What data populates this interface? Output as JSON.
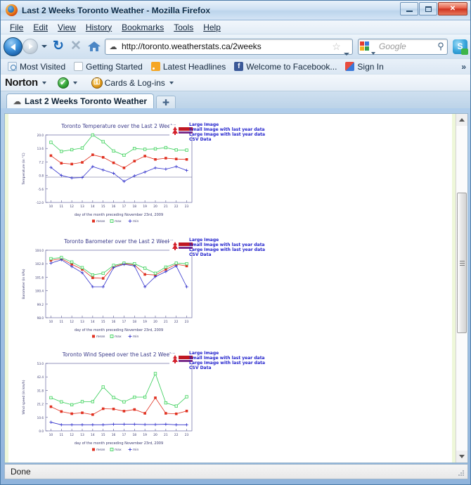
{
  "window": {
    "title": "Last 2 Weeks Toronto Weather - Mozilla Firefox",
    "minimize_label": "–",
    "maximize_label": "❐",
    "close_label": "✕"
  },
  "menubar": {
    "items": [
      {
        "label": "File",
        "accel": "F"
      },
      {
        "label": "Edit",
        "accel": "E"
      },
      {
        "label": "View",
        "accel": "V"
      },
      {
        "label": "History",
        "accel": "s"
      },
      {
        "label": "Bookmarks",
        "accel": "B"
      },
      {
        "label": "Tools",
        "accel": "T"
      },
      {
        "label": "Help",
        "accel": "H"
      }
    ]
  },
  "navbar": {
    "back_icon": "back-arrow-icon",
    "forward_icon": "forward-arrow-icon",
    "history_dropdown_icon": "chevron-down-icon",
    "reload_label": "↻",
    "stop_label": "✕",
    "home_icon": "home-icon",
    "url": "http://toronto.weatherstats.ca/2weeks",
    "url_favicon": "weather-cloud-icon",
    "bookmark_star": "☆",
    "url_dropdown_icon": "chevron-down-icon",
    "search_placeholder": "Google",
    "search_engine_icon": "google-icon",
    "search_submit_icon": "magnifier-icon",
    "magnifier_label": "⚲",
    "skype_label": "S",
    "skype_icon": "skype-icon"
  },
  "bookmarks": {
    "items": [
      {
        "label": "Most Visited",
        "icon": "most-visited-icon"
      },
      {
        "label": "Getting Started",
        "icon": "page-icon"
      },
      {
        "label": "Latest Headlines",
        "icon": "rss-icon"
      },
      {
        "label": "Welcome to Facebook...",
        "icon": "facebook-icon"
      },
      {
        "label": "Sign In",
        "icon": "windows-icon"
      }
    ],
    "overflow_label": "»"
  },
  "norton": {
    "brand": "Norton",
    "status_icon": "green-check-icon",
    "status_label": "✔",
    "vault_icon": "lock-icon",
    "vault_label": "⚿",
    "cards_label": "Cards & Log-ins"
  },
  "tabs": {
    "active": {
      "label": "Last 2 Weeks Toronto Weather",
      "icon": "weather-cloud-icon"
    },
    "new_tab_label": "✚"
  },
  "statusbar": {
    "text": "Done"
  },
  "page_links": [
    "Large Image",
    "Small Image with last year data",
    "Large Image with last year data",
    "CSV Data"
  ],
  "chart_data": [
    {
      "type": "line",
      "title": "Toronto Temperature over the Last 2 Weeks",
      "xlabel": "day of the month preceding November 23rd, 2009",
      "ylabel": "Temperature (in °C)",
      "categories": [
        "10",
        "11",
        "12",
        "13",
        "14",
        "15",
        "16",
        "17",
        "18",
        "19",
        "20",
        "21",
        "22",
        "23"
      ],
      "yticks": [
        20.0,
        13.6,
        7.2,
        0.8,
        -5.6,
        -12.0
      ],
      "ylim": [
        -12.0,
        20.0
      ],
      "legend": [
        "mean",
        "max",
        "min"
      ],
      "legend_position": "bottom",
      "grid": false,
      "series": [
        {
          "name": "mean",
          "color": "#e03020",
          "values": [
            10.2,
            6.6,
            6.2,
            7.0,
            10.6,
            9.4,
            6.8,
            4.4,
            7.6,
            10.0,
            8.4,
            9.0,
            8.6,
            8.4
          ]
        },
        {
          "name": "max",
          "color": "#33cc55",
          "values": [
            16.5,
            12.2,
            13.0,
            13.8,
            20.0,
            16.8,
            12.4,
            10.4,
            13.6,
            13.2,
            13.4,
            14.0,
            12.9,
            12.8
          ]
        },
        {
          "name": "min",
          "color": "#3333cc",
          "values": [
            4.6,
            0.8,
            -0.4,
            -0.2,
            5.0,
            3.4,
            1.8,
            -2.0,
            0.6,
            2.4,
            4.4,
            3.8,
            5.0,
            3.2
          ]
        }
      ]
    },
    {
      "type": "line",
      "title": "Toronto Barometer over the Last 2 Weeks",
      "xlabel": "day of the month preceding November 23rd, 2009",
      "ylabel": "Barometer (in kPa)",
      "categories": [
        "10",
        "11",
        "12",
        "13",
        "14",
        "15",
        "16",
        "17",
        "18",
        "19",
        "20",
        "21",
        "22",
        "23"
      ],
      "yticks": [
        104.0,
        102.8,
        101.6,
        100.4,
        99.2,
        98.0
      ],
      "ylim": [
        98.0,
        104.0
      ],
      "legend": [
        "mean",
        "max",
        "min"
      ],
      "legend_position": "bottom",
      "grid": false,
      "series": [
        {
          "name": "mean",
          "color": "#e03020",
          "values": [
            103.1,
            103.25,
            102.75,
            102.3,
            101.55,
            101.5,
            102.55,
            102.8,
            102.7,
            101.85,
            101.8,
            102.3,
            102.75,
            102.6
          ]
        },
        {
          "name": "max",
          "color": "#33cc55",
          "values": [
            103.25,
            103.35,
            102.95,
            102.45,
            101.8,
            101.95,
            102.65,
            102.85,
            102.8,
            102.4,
            101.95,
            102.5,
            102.85,
            102.8
          ]
        },
        {
          "name": "min",
          "color": "#3333cc",
          "values": [
            102.85,
            103.15,
            102.55,
            102.0,
            100.75,
            100.75,
            102.45,
            102.75,
            102.6,
            100.75,
            101.65,
            102.1,
            102.6,
            100.75
          ]
        }
      ]
    },
    {
      "type": "line",
      "title": "Toronto Wind Speed over the Last 2 Weeks",
      "xlabel": "day of the month preceding November 23rd, 2009",
      "ylabel": "Wind speed (in km/h)",
      "categories": [
        "10",
        "11",
        "12",
        "13",
        "14",
        "15",
        "16",
        "17",
        "18",
        "19",
        "20",
        "21",
        "22",
        "23"
      ],
      "yticks": [
        53.0,
        42.4,
        31.8,
        21.2,
        10.6,
        0.0
      ],
      "ylim": [
        0.0,
        53.0
      ],
      "legend": [
        "mean",
        "max",
        "min"
      ],
      "legend_position": "bottom",
      "grid": false,
      "series": [
        {
          "name": "mean",
          "color": "#e03020",
          "values": [
            19.0,
            15.2,
            13.5,
            14.2,
            12.8,
            17.4,
            17.2,
            15.5,
            16.8,
            13.8,
            26.0,
            13.8,
            13.4,
            15.6
          ]
        },
        {
          "name": "max",
          "color": "#33cc55",
          "values": [
            26.0,
            22.8,
            20.5,
            23.0,
            23.0,
            34.5,
            26.2,
            22.8,
            26.5,
            26.5,
            45.0,
            22.0,
            19.5,
            26.8
          ]
        },
        {
          "name": "min",
          "color": "#3333cc",
          "values": [
            6.8,
            4.8,
            4.8,
            4.8,
            4.8,
            4.8,
            5.2,
            5.2,
            5.2,
            5.0,
            5.0,
            5.2,
            4.8,
            4.8
          ]
        }
      ]
    }
  ]
}
